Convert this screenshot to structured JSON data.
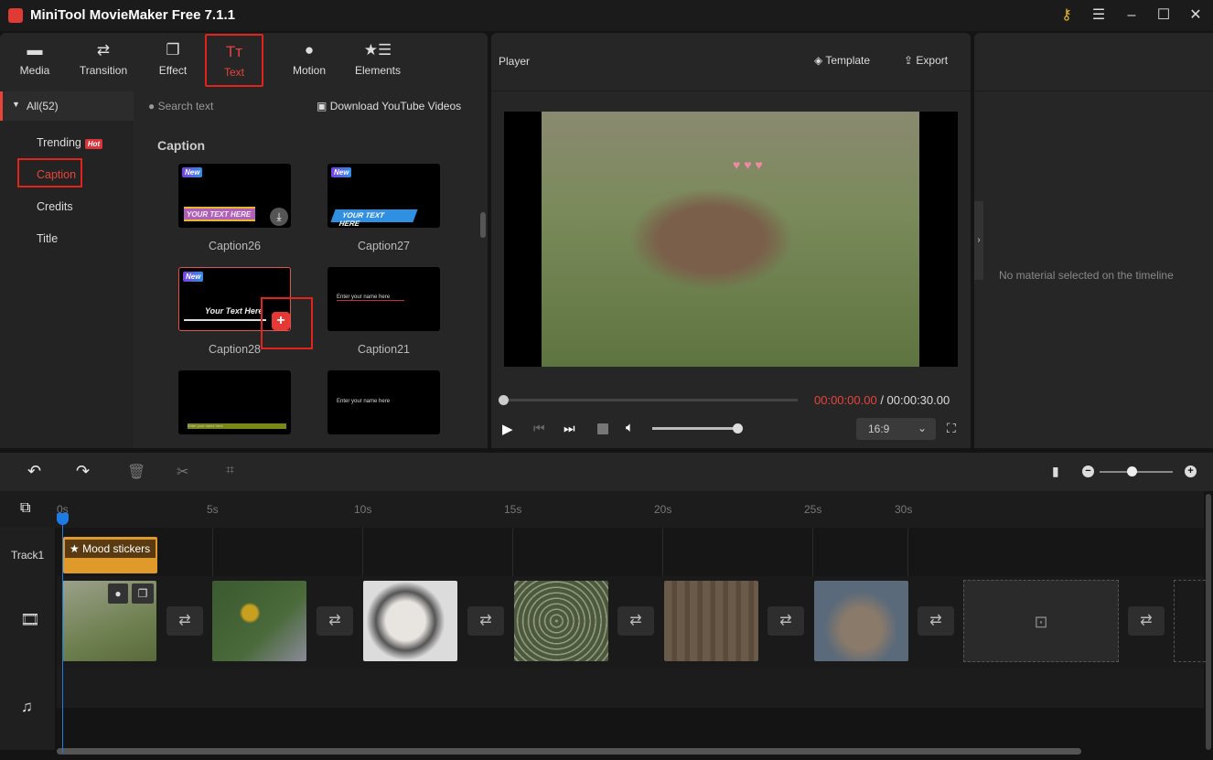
{
  "app": {
    "title": "MiniTool MovieMaker Free 7.1.1"
  },
  "toolbar": {
    "items": [
      {
        "label": "Media",
        "icon": "folder-icon"
      },
      {
        "label": "Transition",
        "icon": "transition-icon"
      },
      {
        "label": "Effect",
        "icon": "effect-icon"
      },
      {
        "label": "Text",
        "icon": "text-icon",
        "active": true
      },
      {
        "label": "Motion",
        "icon": "motion-icon"
      },
      {
        "label": "Elements",
        "icon": "elements-icon"
      }
    ]
  },
  "sidebar": {
    "all": "All(52)",
    "items": [
      {
        "label": "Trending",
        "badge": "Hot"
      },
      {
        "label": "Caption",
        "selected": true
      },
      {
        "label": "Credits"
      },
      {
        "label": "Title"
      }
    ]
  },
  "library": {
    "search_placeholder": "Search text",
    "download_label": "Download YouTube Videos",
    "section": "Caption",
    "new_badge": "New",
    "items": [
      {
        "name": "Caption26",
        "preview": "YOUR TEXT HERE"
      },
      {
        "name": "Caption27",
        "preview": "YOUR TEXT HERE"
      },
      {
        "name": "Caption28",
        "preview": "Your Text Here"
      },
      {
        "name": "Caption21",
        "preview": "Enter your name here"
      },
      {
        "name": "",
        "preview": "Enter your name here"
      },
      {
        "name": "",
        "preview": "Enter your name here"
      }
    ]
  },
  "player": {
    "title": "Player",
    "template": "Template",
    "export": "Export",
    "current_time": "00:00:00.00",
    "total_time": "/ 00:00:30.00",
    "aspect": "16:9",
    "volume": 1.0,
    "progress": 0
  },
  "properties": {
    "empty": "No material selected on the timeline"
  },
  "timeline": {
    "ticks": [
      "0s",
      "5s",
      "10s",
      "15s",
      "20s",
      "25s",
      "30s"
    ],
    "track1": "Track1",
    "sticker_clip": "Mood stickers"
  },
  "colors": {
    "accent": "#e8443c",
    "playhead": "#1e7be6",
    "sticker": "#e09a2a"
  }
}
